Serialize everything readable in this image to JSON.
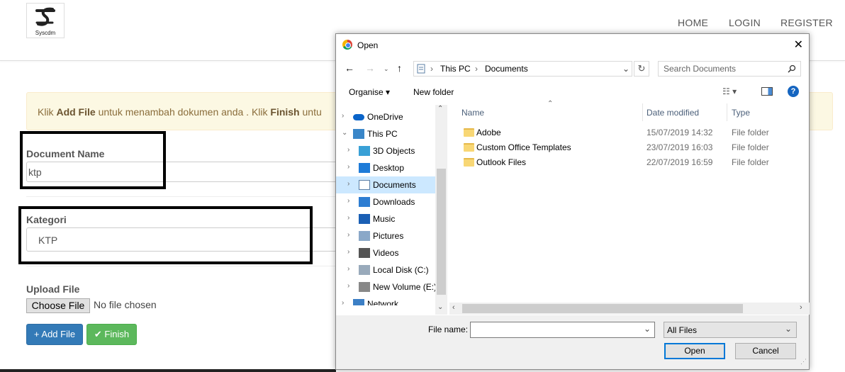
{
  "site": {
    "logo_text": "Syscdm",
    "nav": [
      "HOME",
      "LOGIN",
      "REGISTER"
    ]
  },
  "alert": {
    "p1": "Klik ",
    "b1": "Add File",
    "p2": " untuk menambah dokumen anda . Klik ",
    "b2": "Finish",
    "p3": " untu"
  },
  "form": {
    "doc_name_label": "Document Name",
    "doc_name_value": "ktp",
    "kategori_label": "Kategori",
    "kategori_value": "KTP",
    "upload_label": "Upload File",
    "choose_file": "Choose File",
    "no_file": "No file chosen",
    "add_file": "+ Add File",
    "finish": "✔ Finish"
  },
  "dialog": {
    "title": "Open",
    "close": "✕",
    "breadcrumb": [
      "This PC",
      "Documents"
    ],
    "search_placeholder": "Search Documents",
    "organise": "Organise ▾",
    "new_folder": "New folder",
    "tree": [
      {
        "label": "OneDrive",
        "icon": "cloud-icon",
        "chev": "›",
        "indent": 0
      },
      {
        "label": "This PC",
        "icon": "computer-icon",
        "chev": "⌄",
        "indent": 0
      },
      {
        "label": "3D Objects",
        "icon": "cube-icon",
        "chev": "›",
        "indent": 1
      },
      {
        "label": "Desktop",
        "icon": "desktop-icon",
        "chev": "›",
        "indent": 1
      },
      {
        "label": "Documents",
        "icon": "document-icon",
        "chev": "›",
        "indent": 1,
        "selected": true
      },
      {
        "label": "Downloads",
        "icon": "download-icon",
        "chev": "›",
        "indent": 1
      },
      {
        "label": "Music",
        "icon": "music-icon",
        "chev": "›",
        "indent": 1
      },
      {
        "label": "Pictures",
        "icon": "picture-icon",
        "chev": "›",
        "indent": 1
      },
      {
        "label": "Videos",
        "icon": "video-icon",
        "chev": "›",
        "indent": 1
      },
      {
        "label": "Local Disk (C:)",
        "icon": "disk-icon",
        "chev": "›",
        "indent": 1
      },
      {
        "label": "New Volume (E:)",
        "icon": "drive-icon",
        "chev": "›",
        "indent": 1
      },
      {
        "label": "Network",
        "icon": "network-icon",
        "chev": "›",
        "indent": 0
      }
    ],
    "columns": {
      "name": "Name",
      "date": "Date modified",
      "type": "Type"
    },
    "files": [
      {
        "name": "Adobe",
        "date": "15/07/2019 14:32",
        "type": "File folder"
      },
      {
        "name": "Custom Office Templates",
        "date": "23/07/2019 16:03",
        "type": "File folder"
      },
      {
        "name": "Outlook Files",
        "date": "22/07/2019 16:59",
        "type": "File folder"
      }
    ],
    "file_name_label": "File name:",
    "file_name_value": "",
    "file_type": "All Files",
    "open_btn": "Open",
    "cancel_btn": "Cancel"
  }
}
